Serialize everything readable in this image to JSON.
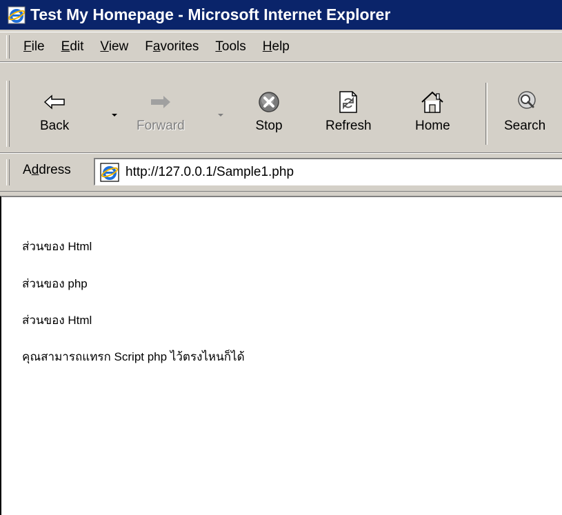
{
  "window": {
    "title": "Test My Homepage - Microsoft Internet Explorer"
  },
  "menu": {
    "items": [
      {
        "label": "File",
        "accel": "F",
        "rest": "ile"
      },
      {
        "label": "Edit",
        "accel": "E",
        "rest": "dit"
      },
      {
        "label": "View",
        "accel": "V",
        "rest": "iew"
      },
      {
        "label": "Favorites",
        "pre": "F",
        "accel": "a",
        "rest": "vorites"
      },
      {
        "label": "Tools",
        "accel": "T",
        "rest": "ools"
      },
      {
        "label": "Help",
        "accel": "H",
        "rest": "elp"
      }
    ]
  },
  "toolbar": {
    "back_label": "Back",
    "forward_label": "Forward",
    "stop_label": "Stop",
    "refresh_label": "Refresh",
    "home_label": "Home",
    "search_label": "Search"
  },
  "address": {
    "label_pre": "A",
    "label_accel": "d",
    "label_rest": "dress",
    "url": "http://127.0.0.1/Sample1.php"
  },
  "content": {
    "lines": [
      "ส่วนของ Html",
      "ส่วนของ php",
      "ส่วนของ Html",
      "คุณสามารถแทรก Script php ไว้ตรงไหนก็ได้"
    ]
  },
  "colors": {
    "titlebar": "#0a246a",
    "chrome": "#d4d0c8",
    "page_background": "#ffffff"
  },
  "icons": {
    "title": "ie-logo-icon",
    "back": "back-arrow-icon",
    "forward": "forward-arrow-icon",
    "stop": "stop-icon",
    "refresh": "refresh-icon",
    "home": "home-icon",
    "search": "search-icon",
    "address": "ie-page-icon"
  }
}
